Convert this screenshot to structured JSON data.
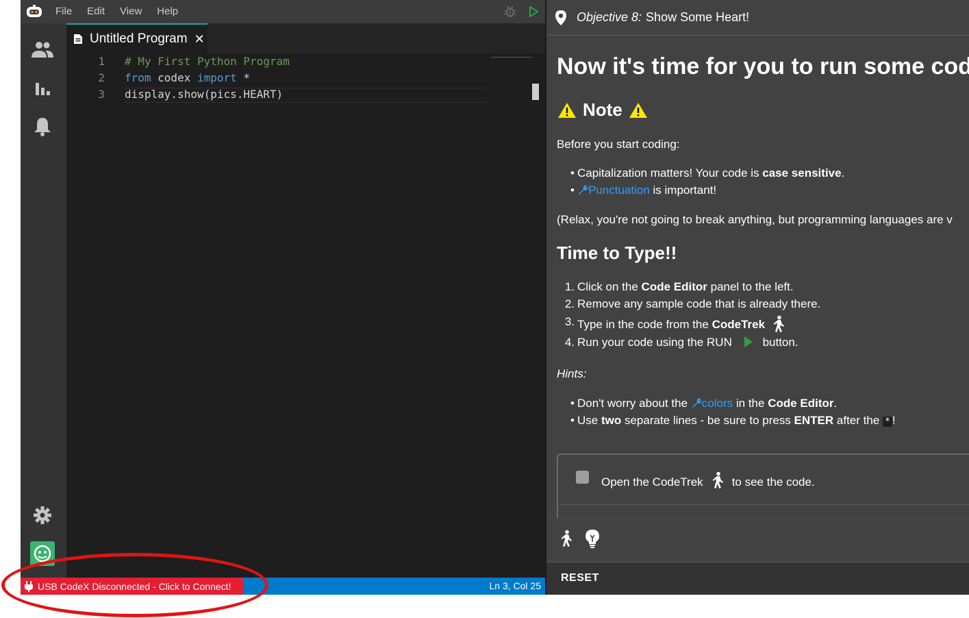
{
  "menubar": {
    "items": [
      "File",
      "Edit",
      "View",
      "Help"
    ],
    "icons": [
      "bot-logo-icon",
      "debug-bug-icon",
      "run-play-icon"
    ]
  },
  "activitybar": {
    "icons": [
      "users-icon",
      "bar-chart-icon",
      "bell-icon",
      "gear-icon",
      "codex-avatar-icon"
    ]
  },
  "editor": {
    "tab_title": "Untitled Program",
    "tab_close": "✕",
    "lines": [
      {
        "num": "1",
        "tokens": [
          {
            "t": "# My First Python Program",
            "c": "comment"
          }
        ]
      },
      {
        "num": "2",
        "tokens": [
          {
            "t": "from",
            "c": "kw"
          },
          {
            "t": " codex ",
            "c": "plain"
          },
          {
            "t": "import",
            "c": "kw"
          },
          {
            "t": " *",
            "c": "plain"
          }
        ]
      },
      {
        "num": "3",
        "tokens": [
          {
            "t": "display.show(pics.HEART)",
            "c": "plain"
          }
        ]
      }
    ]
  },
  "statusbar": {
    "usb_text": "USB CodeX Disconnected - Click to Connect!",
    "cursor_pos": "Ln 3, Col 25"
  },
  "objective": {
    "label": "Objective 8:",
    "title": "Show Some Heart!"
  },
  "content": {
    "heading": "Now it's time for you to run some code",
    "note_title": "Note",
    "note_intro": "Before you start coding:",
    "bullet1_pre": "Capitalization matters! Your code is ",
    "bullet1_bold": "case sensitive",
    "bullet1_post": ".",
    "bullet2_link": "Punctuation",
    "bullet2_post": " is important!",
    "relax": "(Relax, you're not going to break anything, but programming languages are v",
    "type_heading": "Time to Type!!",
    "step1_pre": "Click on the ",
    "step1_bold": "Code Editor",
    "step1_post": " panel to the left.",
    "step2": "Remove any sample code that is already there.",
    "step3_pre": "Type in the code from the ",
    "step3_bold": "CodeTrek",
    "step4_pre": "Run your code using the RUN",
    "step4_post": "button.",
    "hints_label": "Hints:",
    "hint1_pre": "Don't worry about the ",
    "hint1_link": "colors",
    "hint1_mid": " in the ",
    "hint1_bold": "Code Editor",
    "hint1_post": ".",
    "hint2_pre": "Use ",
    "hint2_bold1": "two",
    "hint2_mid": " separate lines - be sure to press ",
    "hint2_bold2": "ENTER",
    "hint2_post1": " after the ",
    "hint2_kbd": "*",
    "hint2_post2": "!",
    "checkbox_pre": "Open the CodeTrek",
    "checkbox_post": "to see the code."
  },
  "footer": {
    "reset_label": "RESET"
  },
  "colors": {
    "accent": "#007acc",
    "usb_error": "#e51e33",
    "link": "#2e9cff",
    "warning": "#ffe600",
    "run_green": "#2ea043",
    "annotation": "#e01414"
  }
}
